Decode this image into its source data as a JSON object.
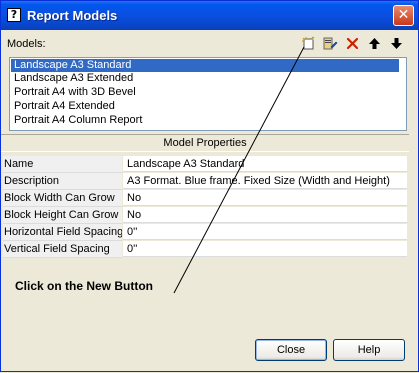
{
  "window": {
    "title": "Report Models",
    "app_icon": "help-question-icon",
    "close_glyph": "✕"
  },
  "models": {
    "label": "Models:",
    "toolbar": [
      {
        "name": "new-button",
        "icon": "new-document-icon"
      },
      {
        "name": "properties-button",
        "icon": "edit-properties-icon"
      },
      {
        "name": "delete-button",
        "icon": "delete-x-icon"
      },
      {
        "name": "move-up-button",
        "icon": "arrow-up-icon"
      },
      {
        "name": "move-down-button",
        "icon": "arrow-down-icon"
      }
    ],
    "items": [
      "Landscape A3 Standard",
      "Landscape A3 Extended",
      "Portrait A4 with 3D Bevel",
      "Portrait A4 Extended",
      "Portrait A4 Column Report"
    ],
    "selected_index": 0
  },
  "properties": {
    "header": "Model Properties",
    "rows": [
      {
        "key": "Name",
        "value": "Landscape A3 Standard"
      },
      {
        "key": "Description",
        "value": "A3 Format. Blue frame. Fixed Size (Width and Height)"
      },
      {
        "key": "Block Width Can Grow",
        "value": "No"
      },
      {
        "key": "Block Height Can Grow",
        "value": "No"
      },
      {
        "key": "Horizontal Field Spacing",
        "value": "0''"
      },
      {
        "key": "Vertical Field Spacing",
        "value": "0''"
      }
    ]
  },
  "annotation": {
    "text": "Click on the New Button"
  },
  "buttons": {
    "close": "Close",
    "help": "Help"
  },
  "colors": {
    "title_bar": "#0a4fe0",
    "selection": "#316ac5",
    "delete_icon": "#cc2200"
  }
}
